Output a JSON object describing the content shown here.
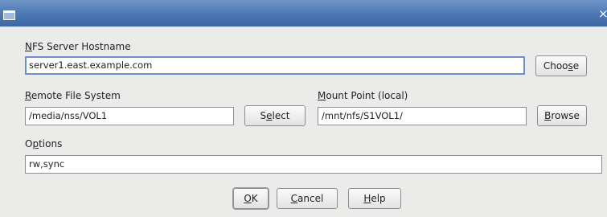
{
  "hostname": {
    "label_accel": "N",
    "label_rest": "FS Server Hostname",
    "value": "server1.east.example.com",
    "choose_pre": "Choo",
    "choose_accel": "s",
    "choose_post": "e"
  },
  "remote": {
    "label_accel": "R",
    "label_rest": "emote File System",
    "value": "/media/nss/VOL1",
    "select_pre": "S",
    "select_accel": "e",
    "select_post": "lect"
  },
  "mount": {
    "label_accel": "M",
    "label_rest": "ount Point (local)",
    "value": "/mnt/nfs/S1VOL1/",
    "browse_accel": "B",
    "browse_post": "rowse"
  },
  "options": {
    "label_pre": "O",
    "label_accel": "p",
    "label_post": "tions",
    "value": "rw,sync"
  },
  "footer": {
    "ok_accel": "O",
    "ok_post": "K",
    "cancel_accel": "C",
    "cancel_post": "ancel",
    "help_accel": "H",
    "help_post": "elp"
  },
  "title_bar": {
    "close_glyph": "×"
  }
}
